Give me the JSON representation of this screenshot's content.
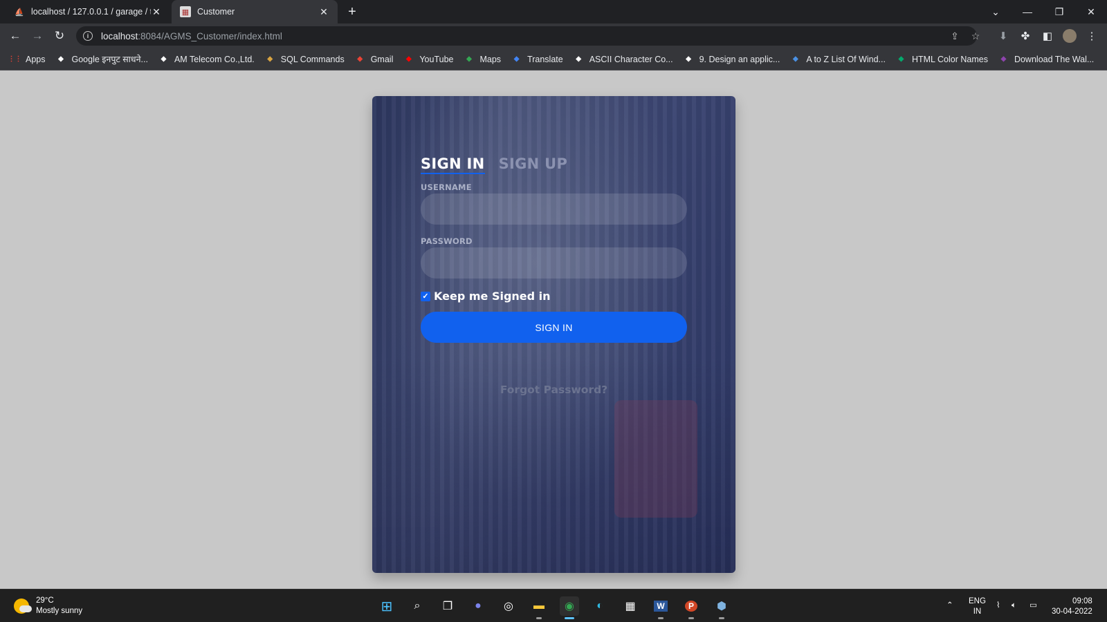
{
  "browser": {
    "tabs": [
      {
        "title": "localhost / 127.0.0.1 / garage / tw",
        "active": false
      },
      {
        "title": "Customer",
        "active": true
      }
    ],
    "url_host": "localhost",
    "url_rest": ":8084/AGMS_Customer/index.html",
    "bookmarks": [
      {
        "label": "Apps",
        "icon": "apps-grid-icon",
        "color": "#ea4335"
      },
      {
        "label": "Google इनपुट साधने...",
        "icon": "google-icon",
        "color": "#ffffff"
      },
      {
        "label": "AM Telecom Co.,Ltd.",
        "icon": "globe-icon",
        "color": "#ffffff"
      },
      {
        "label": "SQL Commands",
        "icon": "sql-icon",
        "color": "#d9a441"
      },
      {
        "label": "Gmail",
        "icon": "gmail-icon",
        "color": "#ea4335"
      },
      {
        "label": "YouTube",
        "icon": "youtube-icon",
        "color": "#ff0000"
      },
      {
        "label": "Maps",
        "icon": "maps-icon",
        "color": "#34a853"
      },
      {
        "label": "Translate",
        "icon": "translate-icon",
        "color": "#4285f4"
      },
      {
        "label": "ASCII Character Co...",
        "icon": "ascii-icon",
        "color": "#ffffff"
      },
      {
        "label": "9. Design an applic...",
        "icon": "wordpress-icon",
        "color": "#ffffff"
      },
      {
        "label": "A to Z List Of Wind...",
        "icon": "doc-icon",
        "color": "#4a90e2"
      },
      {
        "label": "HTML Color Names",
        "icon": "w3-icon",
        "color": "#04aa6d"
      },
      {
        "label": "Download The Wal...",
        "icon": "wallpaper-icon",
        "color": "#8e44ad"
      }
    ]
  },
  "login": {
    "tab_signin": "SIGN IN",
    "tab_signup": "SIGN UP",
    "username_label": "USERNAME",
    "username_value": "",
    "password_label": "PASSWORD",
    "password_value": "",
    "keep_signed_in": "Keep me Signed in",
    "keep_signed_in_checked": true,
    "submit": "SIGN IN",
    "forgot": "Forgot Password?"
  },
  "taskbar": {
    "temp": "29°C",
    "weather": "Mostly sunny",
    "lang_top": "ENG",
    "lang_bottom": "IN",
    "time": "09:08",
    "date": "30-04-2022"
  }
}
